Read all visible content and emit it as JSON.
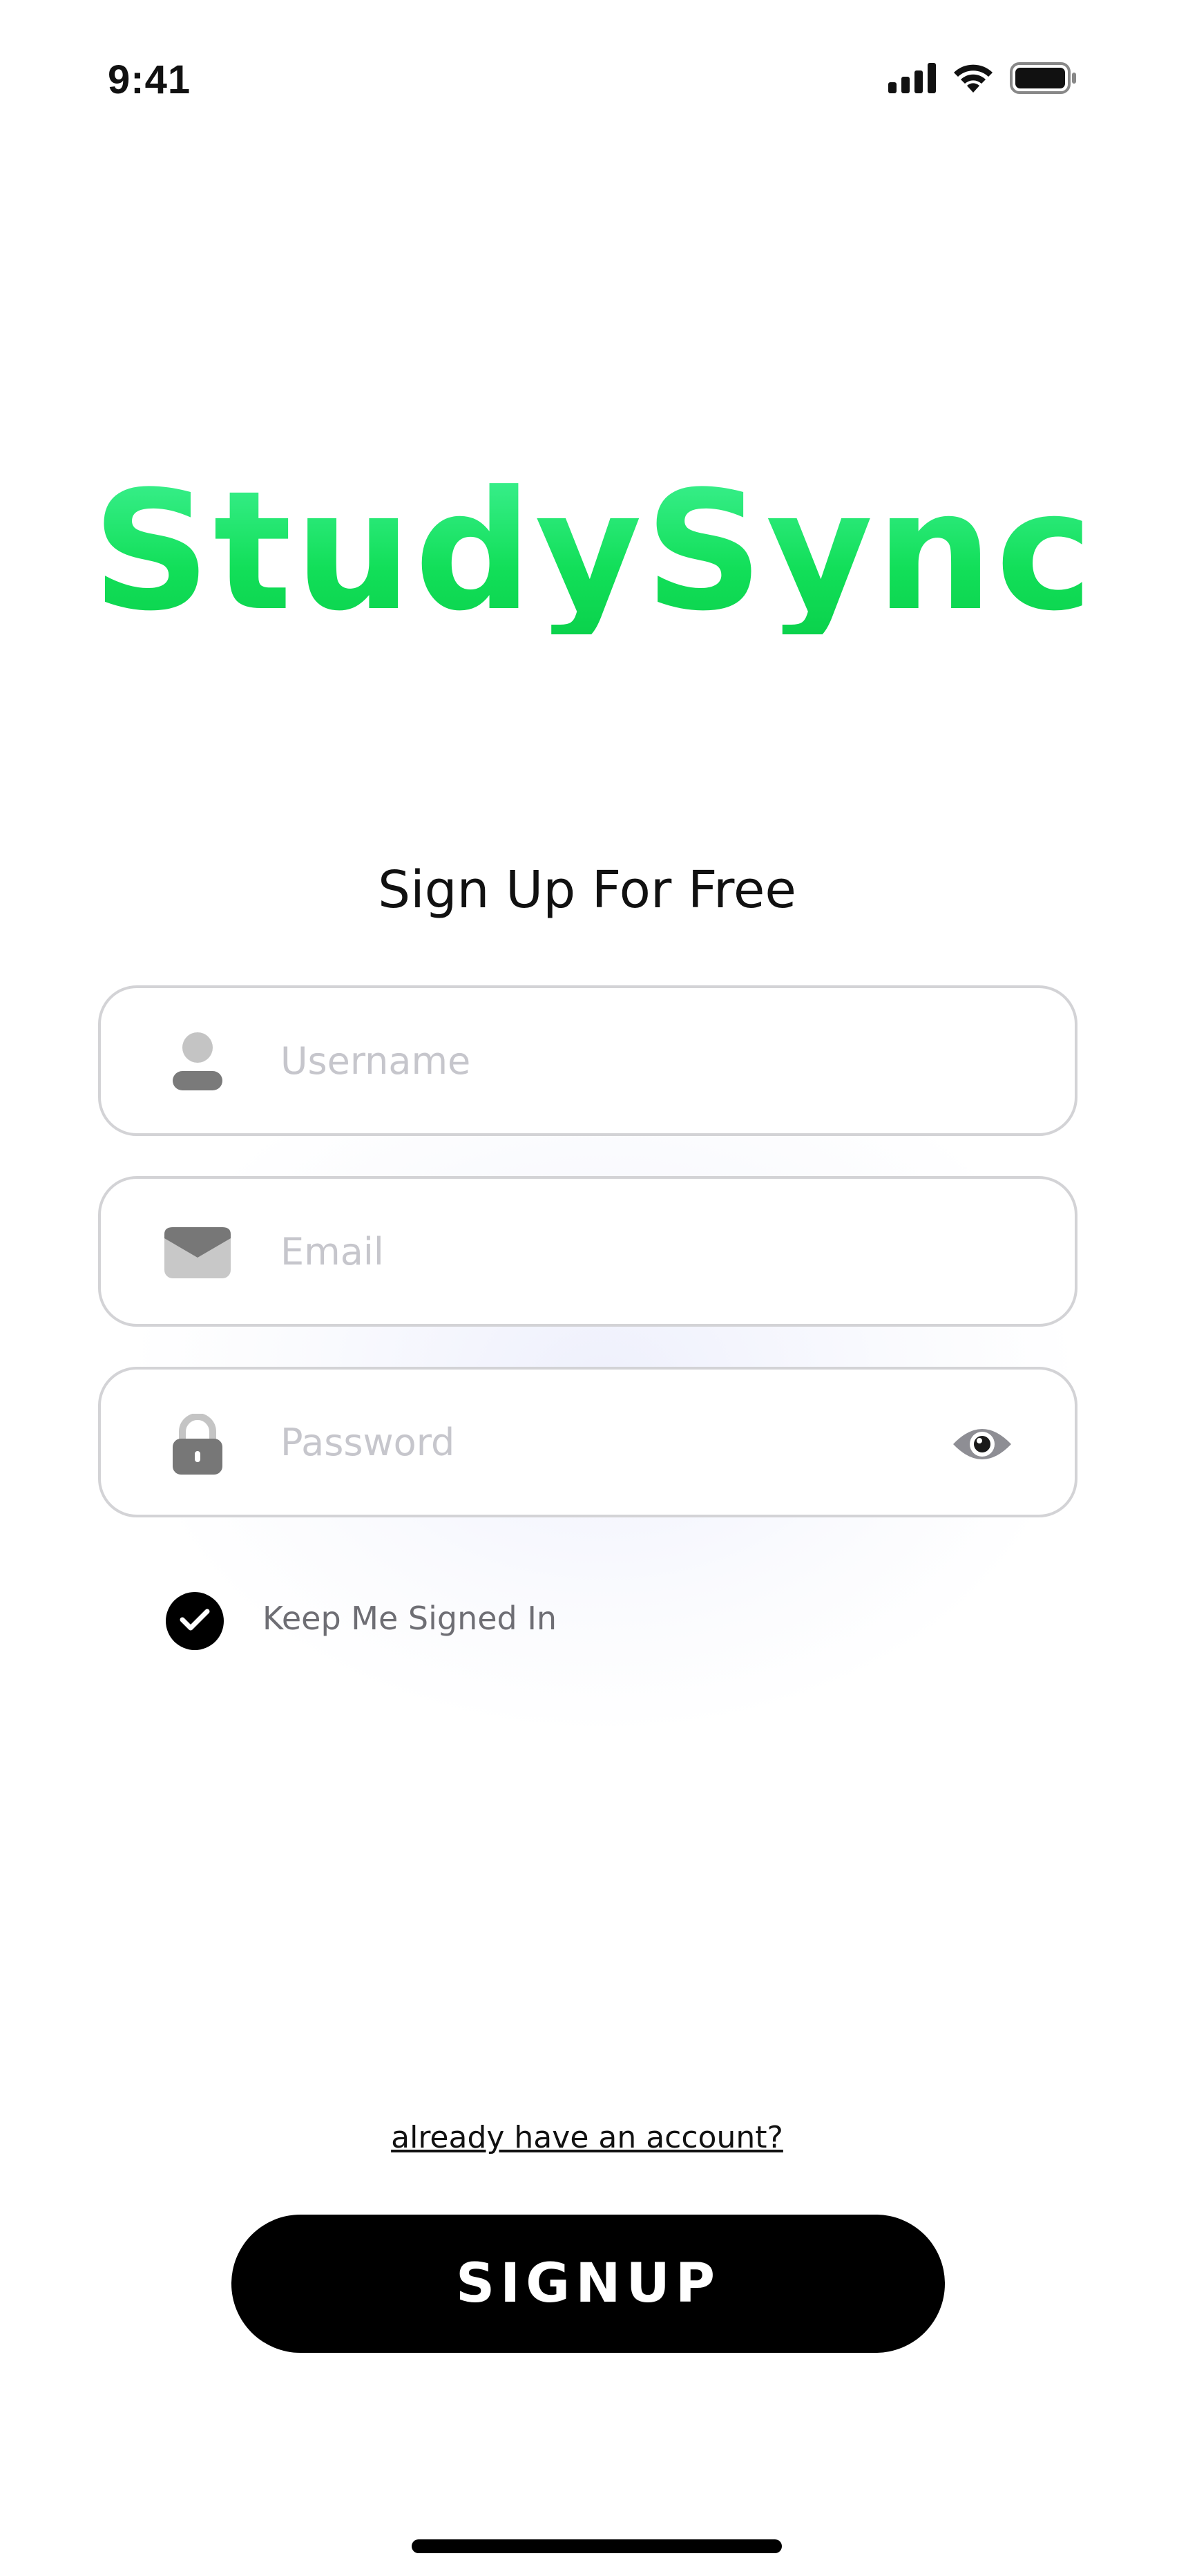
{
  "status_bar": {
    "time": "9:41",
    "icons": [
      "cellular-signal-icon",
      "wifi-icon",
      "battery-icon"
    ]
  },
  "app": {
    "logo_text": "StudySync",
    "brand_color": "#12df59"
  },
  "form": {
    "heading": "Sign Up For Free",
    "username": {
      "placeholder": "Username",
      "value": "",
      "icon": "user-icon"
    },
    "email": {
      "placeholder": "Email",
      "value": "",
      "icon": "envelope-icon"
    },
    "password": {
      "placeholder": "Password",
      "value": "",
      "icon": "lock-icon",
      "toggle_icon": "eye-icon"
    },
    "keep_signed_in": {
      "label": "Keep Me Signed In",
      "checked": true
    }
  },
  "footer": {
    "login_link": "already have an account?",
    "signup_button": "SIGNUP"
  }
}
